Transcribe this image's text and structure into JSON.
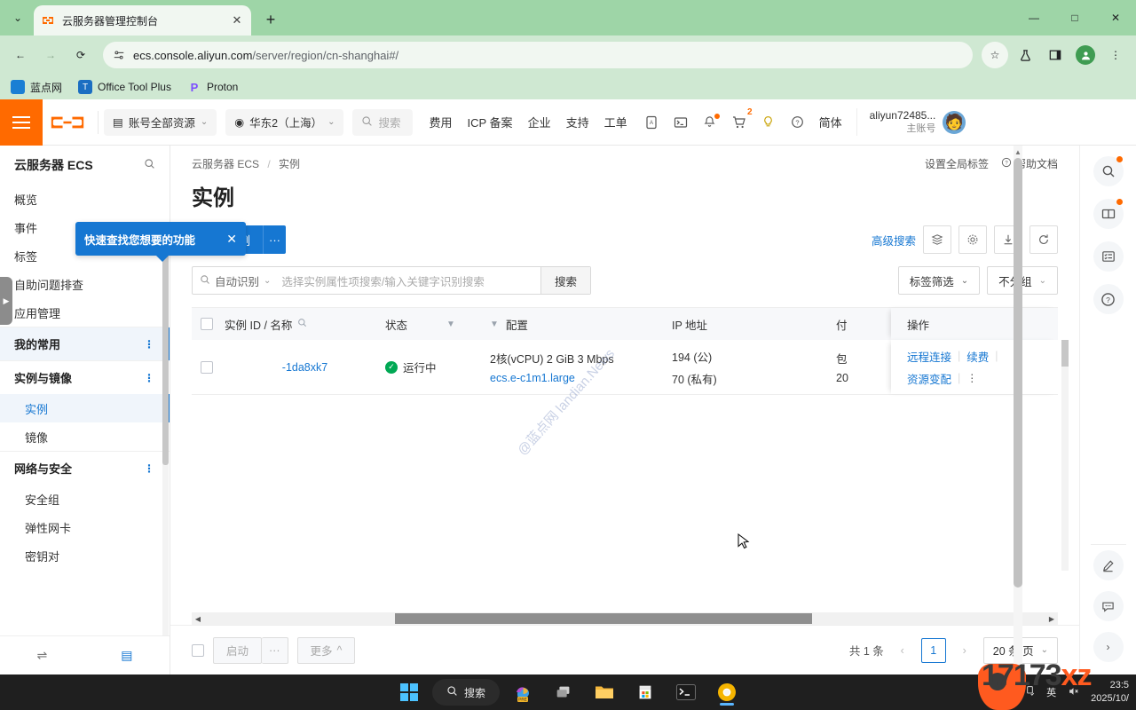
{
  "browser": {
    "tab": {
      "title": "云服务器管理控制台",
      "favicon_label": "C-",
      "close_label": "✕"
    },
    "newtab_label": "+",
    "tab_search_label": "⌄",
    "window_controls": {
      "minimize": "—",
      "maximize": "□",
      "close": "✕"
    },
    "nav": {
      "back": "←",
      "forward": "→",
      "reload": "⟳"
    },
    "address": {
      "url_main": "ecs.console.aliyun.com",
      "url_path": "/server/region/cn-shanghai#/"
    },
    "toolbar_icons": {
      "star": "☆",
      "labs": "flask-icon",
      "sidepanel": "side-panel-icon",
      "profile": "profile-icon",
      "menu": "⋮"
    },
    "bookmarks": [
      {
        "label": "蓝点网",
        "icon_char": "蓝"
      },
      {
        "label": "Office Tool Plus",
        "icon_char": "O"
      },
      {
        "label": "Proton",
        "icon_char": "P"
      }
    ]
  },
  "ali_header": {
    "menu_icon": "hamburger-icon",
    "logo": "aliyun-logo",
    "resource_selector": "账号全部资源",
    "region": "华东2（上海）",
    "search_placeholder": "搜索",
    "nav": [
      "费用",
      "ICP 备案",
      "企业",
      "支持",
      "工单"
    ],
    "icons": [
      {
        "name": "app-icon",
        "glyph": "▤"
      },
      {
        "name": "terminal-icon",
        "glyph": "▶_"
      },
      {
        "name": "bell-icon",
        "glyph": "🔔",
        "dot": true
      },
      {
        "name": "cart-icon",
        "glyph": "🛒",
        "badge": "2"
      },
      {
        "name": "bulb-icon",
        "glyph": "💡"
      },
      {
        "name": "help-icon",
        "glyph": "?"
      }
    ],
    "language": "简体",
    "account_name": "aliyun72485...",
    "account_role": "主账号"
  },
  "tooltip": {
    "text": "快速查找您想要的功能",
    "close": "✕"
  },
  "sidebar": {
    "title": "云服务器 ECS",
    "search_icon": "search-icon",
    "items": [
      {
        "label": "概览"
      },
      {
        "label": "事件"
      },
      {
        "label": "标签"
      },
      {
        "label": "自助问题排查"
      },
      {
        "label": "应用管理"
      }
    ],
    "groups": [
      {
        "label": "我的常用",
        "active": true,
        "children": []
      },
      {
        "label": "实例与镜像",
        "active": false,
        "children": [
          {
            "label": "实例",
            "active": true
          },
          {
            "label": "镜像",
            "active": false
          }
        ]
      },
      {
        "label": "网络与安全",
        "active": false,
        "children": [
          {
            "label": "安全组",
            "active": false
          },
          {
            "label": "弹性网卡",
            "active": false
          },
          {
            "label": "密钥对",
            "active": false
          }
        ]
      }
    ],
    "more_icon": "⋮",
    "footer": {
      "swap_icon": "⇌",
      "doc_icon": "▤"
    },
    "collapse_handle": "▶"
  },
  "main": {
    "breadcrumb": {
      "root": "云服务器 ECS",
      "sep": "/",
      "current": "实例"
    },
    "header_links": [
      {
        "label": "设置全局标签",
        "icon": ""
      },
      {
        "label": "帮助文档",
        "icon": "?"
      }
    ],
    "title": "实例",
    "create_button": "创建实例",
    "create_more": "···",
    "advanced_search": "高级搜索",
    "toolbar_icons": [
      {
        "name": "columns-icon",
        "glyph": "◈"
      },
      {
        "name": "settings-icon",
        "glyph": "⚙"
      },
      {
        "name": "download-icon",
        "glyph": "⤓"
      },
      {
        "name": "refresh-icon",
        "glyph": "⟳"
      }
    ],
    "search": {
      "mode_label": "自动识别",
      "placeholder": "选择实例属性项搜索/输入关键字识别搜索",
      "submit_label": "搜索"
    },
    "tag_filter": "标签筛选",
    "group_filter": "不分组",
    "table": {
      "columns": [
        "实例 ID / 名称",
        "状态",
        "配置",
        "IP 地址",
        "付",
        "操作"
      ],
      "rows": [
        {
          "instance_id": "-1da8xk7",
          "status": "运行中",
          "config_line1": "2核(vCPU)  2 GiB  3 Mbps",
          "config_line2": "ecs.e-c1m1.large",
          "ip_public": "194 (公)",
          "ip_private": "70 (私有)",
          "pay_line1": "包",
          "pay_line2": "20",
          "actions": [
            "远程连接",
            "续费",
            "资源变配"
          ],
          "actions_more": "⋮"
        }
      ]
    },
    "footer": {
      "start_button": "启动",
      "dots_button": "···",
      "more_button": "更多",
      "more_caret": "^",
      "total": "共 1 条",
      "prev": "‹",
      "page": "1",
      "next": "›",
      "page_size": "20 条/页",
      "page_size_caret": "⌄"
    }
  },
  "rail": {
    "top": [
      {
        "name": "search-icon",
        "glyph": "🔍",
        "dot": true
      },
      {
        "name": "docs-icon",
        "glyph": "📖",
        "dot": true
      },
      {
        "name": "tasklist-icon",
        "glyph": "▤",
        "dot": false
      },
      {
        "name": "help-icon",
        "glyph": "?",
        "dot": false
      }
    ],
    "bottom": [
      {
        "name": "feedback-pen-icon",
        "glyph": "✎"
      },
      {
        "name": "chat-icon",
        "glyph": "💬"
      },
      {
        "name": "expand-icon",
        "glyph": "›"
      }
    ]
  },
  "watermarks": {
    "diagonal": "@蓝点网 landian.News",
    "corner_orange": "17173",
    "corner_suffix": "xz"
  },
  "taskbar": {
    "search_label": "搜索",
    "items": [
      {
        "name": "start-button",
        "glyph": ""
      },
      {
        "name": "copilot-button",
        "glyph": "PRE"
      },
      {
        "name": "task-view-button",
        "glyph": "❐"
      },
      {
        "name": "file-explorer-button",
        "glyph": "📁"
      },
      {
        "name": "microsoft-store-button",
        "glyph": "🛍"
      },
      {
        "name": "terminal-button",
        "glyph": ">_"
      },
      {
        "name": "chrome-button",
        "glyph": "◎"
      }
    ],
    "tray": {
      "app_icon": "▶",
      "usb_icon": "usb-icon",
      "ime": "英",
      "volume_icon": "🔇",
      "time": "23:5",
      "date": "2025/10/"
    }
  }
}
